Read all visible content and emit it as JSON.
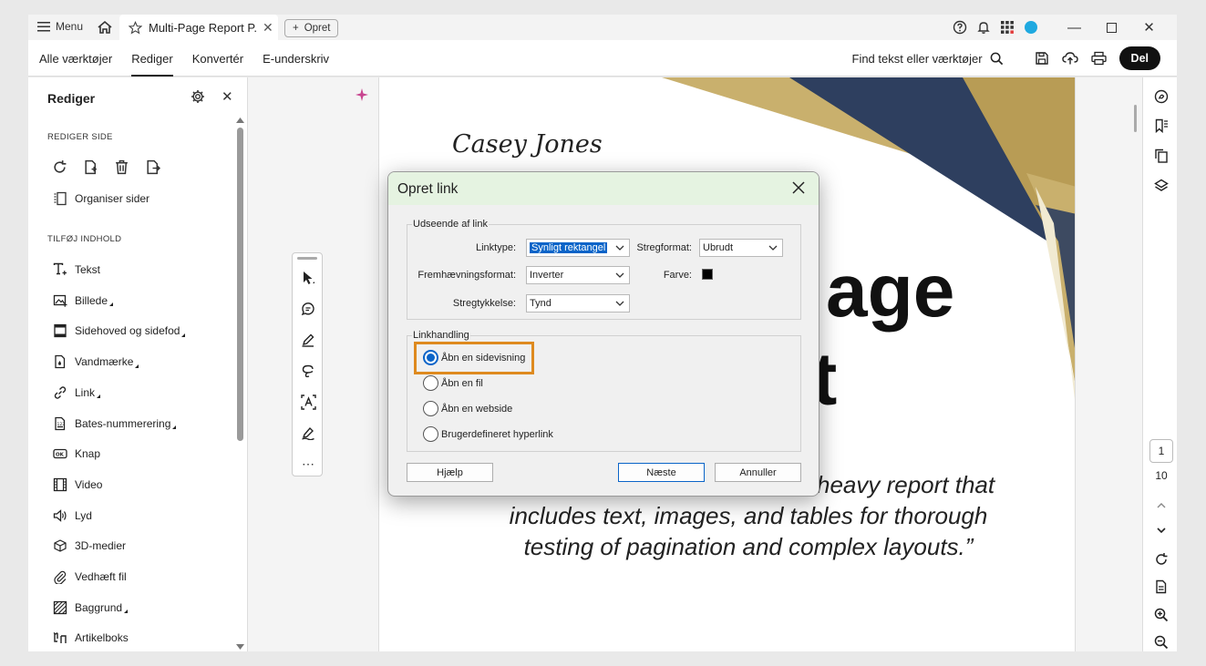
{
  "titlebar": {
    "menu_label": "Menu",
    "tab_title": "Multi-Page Report P...",
    "new_label": "Opret"
  },
  "menubar": {
    "items": [
      "Alle værktøjer",
      "Rediger",
      "Konvertér",
      "E-underskriv"
    ],
    "active": "Rediger",
    "search_label": "Find tekst eller værktøjer",
    "share_label": "Del"
  },
  "left_panel": {
    "title": "Rediger",
    "section_edit_page": "REDIGER SIDE",
    "organize_label": "Organiser sider",
    "section_add_content": "TILFØJ INDHOLD",
    "items": [
      {
        "label": "Tekst",
        "icon": "text-add-icon",
        "caret": false
      },
      {
        "label": "Billede",
        "icon": "image-icon",
        "caret": true
      },
      {
        "label": "Sidehoved og sidefod",
        "icon": "header-footer-icon",
        "caret": true
      },
      {
        "label": "Vandmærke",
        "icon": "watermark-icon",
        "caret": true
      },
      {
        "label": "Link",
        "icon": "link-icon",
        "caret": true
      },
      {
        "label": "Bates-nummerering",
        "icon": "bates-icon",
        "caret": true
      },
      {
        "label": "Knap",
        "icon": "button-icon",
        "caret": false
      },
      {
        "label": "Video",
        "icon": "video-icon",
        "caret": false
      },
      {
        "label": "Lyd",
        "icon": "sound-icon",
        "caret": false
      },
      {
        "label": "3D-medier",
        "icon": "cube-icon",
        "caret": false
      },
      {
        "label": "Vedhæft fil",
        "icon": "paperclip-icon",
        "caret": false
      },
      {
        "label": "Baggrund",
        "icon": "background-icon",
        "caret": true
      },
      {
        "label": "Artikelboks",
        "icon": "article-icon",
        "caret": false
      }
    ]
  },
  "document": {
    "signature": "Casey Jones",
    "title_line1": "age",
    "title_line2": "t",
    "quote_lines": [
      "heavy report that",
      "includes text, images, and tables for thorough",
      "testing of pagination and complex layouts.”"
    ]
  },
  "dialog": {
    "title": "Opret link",
    "appearance_group": "Udseende af link",
    "linktype_label": "Linktype:",
    "linktype_value": "Synligt rektangel",
    "linestyle_label": "Stregformat:",
    "linestyle_value": "Ubrudt",
    "highlight_label": "Fremhævningsformat:",
    "highlight_value": "Inverter",
    "color_label": "Farve:",
    "color_value": "#000000",
    "thickness_label": "Stregtykkelse:",
    "thickness_value": "Tynd",
    "action_group": "Linkhandling",
    "actions": [
      {
        "label": "Åbn en sidevisning",
        "selected": true
      },
      {
        "label": "Åbn en fil",
        "selected": false
      },
      {
        "label": "Åbn en webside",
        "selected": false
      },
      {
        "label": "Brugerdefineret hyperlink",
        "selected": false
      }
    ],
    "help_label": "Hjælp",
    "next_label": "Næste",
    "cancel_label": "Annuller"
  },
  "page_nav": {
    "current": "1",
    "total": "10"
  },
  "colors": {
    "accent_orange": "#de8a1f",
    "select_blue": "#0a64c8",
    "navy": "#2e3f5f",
    "gold": "#c9b06d"
  }
}
